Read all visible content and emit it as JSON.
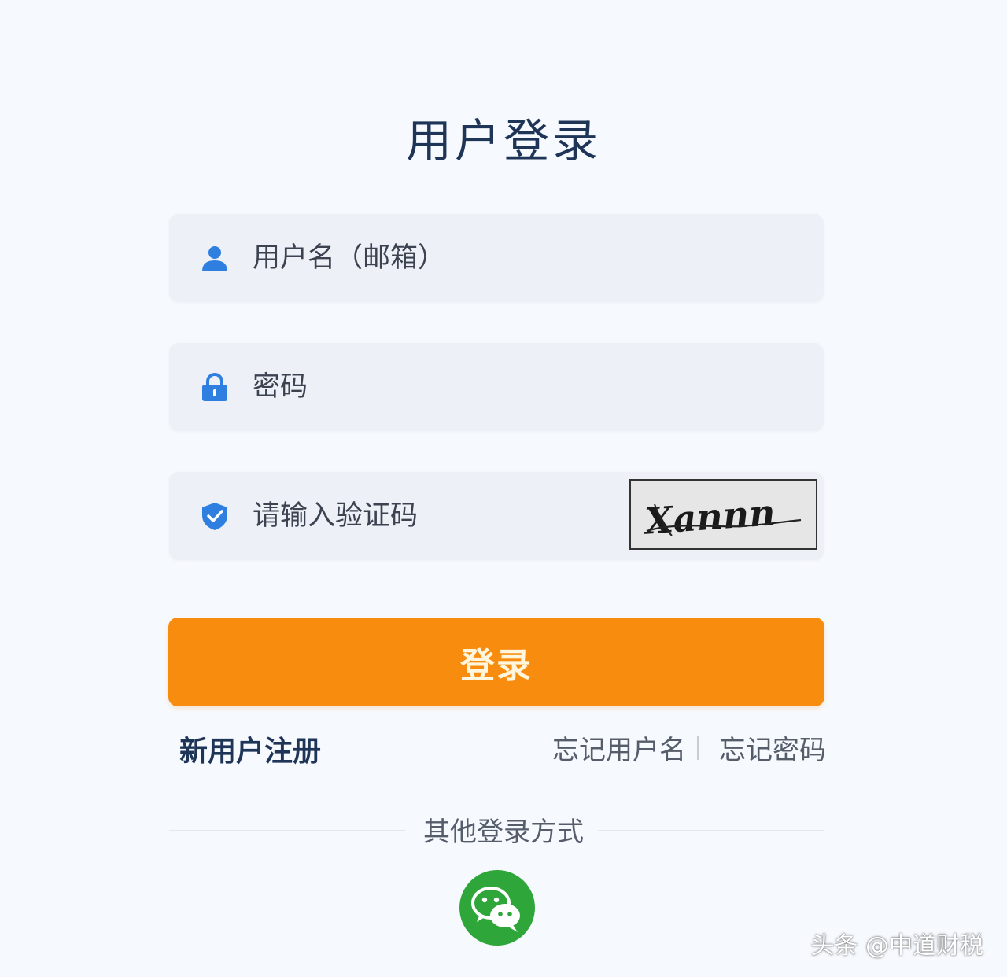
{
  "header": {
    "title": "用户登录"
  },
  "form": {
    "username": {
      "placeholder": "用户名（邮箱）",
      "icon": "user-icon"
    },
    "password": {
      "placeholder": "密码",
      "icon": "lock-icon"
    },
    "captcha": {
      "placeholder": "请输入验证码",
      "icon": "shield-check-icon",
      "image_text": "Xannn"
    },
    "login_label": "登录"
  },
  "links": {
    "register": "新用户注册",
    "forgot_username": "忘记用户名",
    "forgot_password": "忘记密码"
  },
  "other_login": {
    "title": "其他登录方式",
    "wechat_icon": "wechat-icon"
  },
  "watermark": "头条 @中道财税",
  "colors": {
    "accent": "#f78c0e",
    "icon_blue": "#2f7fe0",
    "title": "#1f3557",
    "wechat": "#2ea63a",
    "background": "#f6f9fd",
    "field_bg": "#edf1f7"
  }
}
